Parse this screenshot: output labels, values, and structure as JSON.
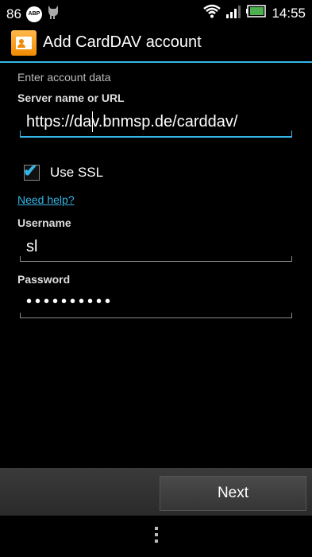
{
  "status_bar": {
    "notification_count": "86",
    "abp_badge": "ABP",
    "time": "14:55",
    "battery_color": "#4caf50"
  },
  "action_bar": {
    "title": "Add CardDAV account",
    "accent_color": "#33b5e5"
  },
  "form": {
    "section_title": "Enter account data",
    "server_label": "Server name or URL",
    "server_value": "https://dav.bnmsp.de/carddav/",
    "ssl_checked": true,
    "ssl_label": "Use SSL",
    "help_link": "Need help?",
    "username_label": "Username",
    "username_value": "sl",
    "password_label": "Password",
    "password_mask": "••••••••••"
  },
  "footer": {
    "next_label": "Next"
  }
}
